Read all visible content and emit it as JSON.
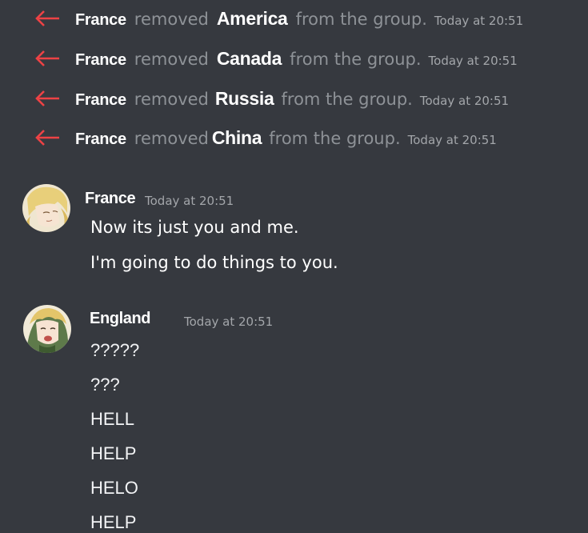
{
  "system_messages": [
    {
      "actor": "France",
      "verb": "removed",
      "target": "America",
      "rest": "from the group.",
      "time": "Today at 20:51"
    },
    {
      "actor": "France",
      "verb": "removed",
      "target": "Canada",
      "rest": "from the group.",
      "time": "Today at 20:51"
    },
    {
      "actor": "France",
      "verb": "removed",
      "target": "Russia",
      "rest": "from the group.",
      "time": "Today at 20:51"
    },
    {
      "actor": "France",
      "verb": "removed",
      "target": "China",
      "rest": "from the group.",
      "time": "Today at 20:51"
    }
  ],
  "messages": [
    {
      "author": "France",
      "time": "Today at 20:51",
      "lines": [
        "Now its just you and me.",
        "I'm going to do things to you."
      ]
    },
    {
      "author": "England",
      "time": "Today at 20:51",
      "lines": [
        "?????",
        "???",
        "HELL",
        "HELP",
        "HELO",
        "HELP"
      ]
    }
  ],
  "colors": {
    "background": "#36393f",
    "remove_arrow": "#ed4245",
    "muted_text": "#8e9297",
    "name_text": "#ffffff"
  }
}
